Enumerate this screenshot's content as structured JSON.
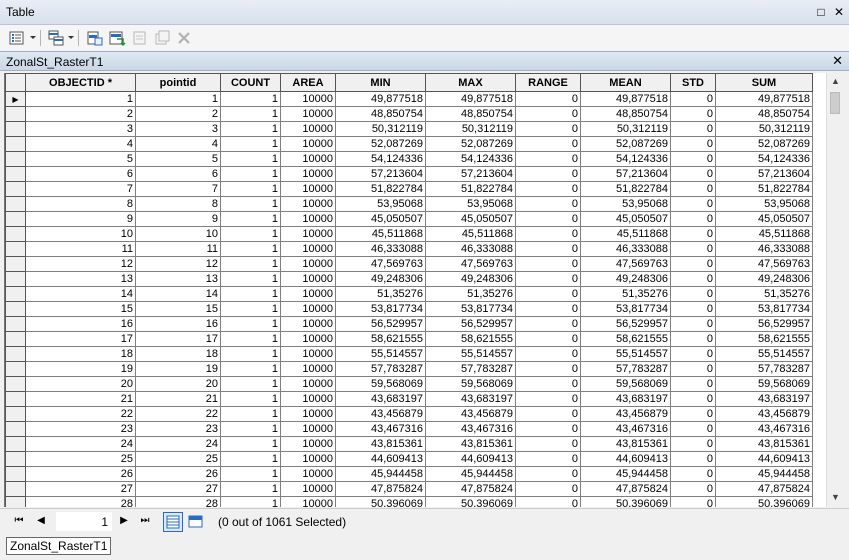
{
  "window": {
    "title": "Table",
    "restore_symbol": "□",
    "close_symbol": "✕"
  },
  "toolbar": {
    "icons": [
      "table-options-icon",
      "related-tables-icon",
      "select-by-attributes-icon",
      "switch-selection-icon",
      "clear-selection-icon",
      "delete-selected-icon",
      "delete-icon"
    ]
  },
  "table_tab": {
    "title": "ZonalSt_RasterT1",
    "close_symbol": "✕"
  },
  "grid": {
    "columns": [
      "OBJECTID *",
      "pointid",
      "COUNT",
      "AREA",
      "MIN",
      "MAX",
      "RANGE",
      "MEAN",
      "STD",
      "SUM"
    ],
    "rows": [
      [
        "1",
        "1",
        "1",
        "10000",
        "49,877518",
        "49,877518",
        "0",
        "49,877518",
        "0",
        "49,877518"
      ],
      [
        "2",
        "2",
        "1",
        "10000",
        "48,850754",
        "48,850754",
        "0",
        "48,850754",
        "0",
        "48,850754"
      ],
      [
        "3",
        "3",
        "1",
        "10000",
        "50,312119",
        "50,312119",
        "0",
        "50,312119",
        "0",
        "50,312119"
      ],
      [
        "4",
        "4",
        "1",
        "10000",
        "52,087269",
        "52,087269",
        "0",
        "52,087269",
        "0",
        "52,087269"
      ],
      [
        "5",
        "5",
        "1",
        "10000",
        "54,124336",
        "54,124336",
        "0",
        "54,124336",
        "0",
        "54,124336"
      ],
      [
        "6",
        "6",
        "1",
        "10000",
        "57,213604",
        "57,213604",
        "0",
        "57,213604",
        "0",
        "57,213604"
      ],
      [
        "7",
        "7",
        "1",
        "10000",
        "51,822784",
        "51,822784",
        "0",
        "51,822784",
        "0",
        "51,822784"
      ],
      [
        "8",
        "8",
        "1",
        "10000",
        "53,95068",
        "53,95068",
        "0",
        "53,95068",
        "0",
        "53,95068"
      ],
      [
        "9",
        "9",
        "1",
        "10000",
        "45,050507",
        "45,050507",
        "0",
        "45,050507",
        "0",
        "45,050507"
      ],
      [
        "10",
        "10",
        "1",
        "10000",
        "45,511868",
        "45,511868",
        "0",
        "45,511868",
        "0",
        "45,511868"
      ],
      [
        "11",
        "11",
        "1",
        "10000",
        "46,333088",
        "46,333088",
        "0",
        "46,333088",
        "0",
        "46,333088"
      ],
      [
        "12",
        "12",
        "1",
        "10000",
        "47,569763",
        "47,569763",
        "0",
        "47,569763",
        "0",
        "47,569763"
      ],
      [
        "13",
        "13",
        "1",
        "10000",
        "49,248306",
        "49,248306",
        "0",
        "49,248306",
        "0",
        "49,248306"
      ],
      [
        "14",
        "14",
        "1",
        "10000",
        "51,35276",
        "51,35276",
        "0",
        "51,35276",
        "0",
        "51,35276"
      ],
      [
        "15",
        "15",
        "1",
        "10000",
        "53,817734",
        "53,817734",
        "0",
        "53,817734",
        "0",
        "53,817734"
      ],
      [
        "16",
        "16",
        "1",
        "10000",
        "56,529957",
        "56,529957",
        "0",
        "56,529957",
        "0",
        "56,529957"
      ],
      [
        "17",
        "17",
        "1",
        "10000",
        "58,621555",
        "58,621555",
        "0",
        "58,621555",
        "0",
        "58,621555"
      ],
      [
        "18",
        "18",
        "1",
        "10000",
        "55,514557",
        "55,514557",
        "0",
        "55,514557",
        "0",
        "55,514557"
      ],
      [
        "19",
        "19",
        "1",
        "10000",
        "57,783287",
        "57,783287",
        "0",
        "57,783287",
        "0",
        "57,783287"
      ],
      [
        "20",
        "20",
        "1",
        "10000",
        "59,568069",
        "59,568069",
        "0",
        "59,568069",
        "0",
        "59,568069"
      ],
      [
        "21",
        "21",
        "1",
        "10000",
        "43,683197",
        "43,683197",
        "0",
        "43,683197",
        "0",
        "43,683197"
      ],
      [
        "22",
        "22",
        "1",
        "10000",
        "43,456879",
        "43,456879",
        "0",
        "43,456879",
        "0",
        "43,456879"
      ],
      [
        "23",
        "23",
        "1",
        "10000",
        "43,467316",
        "43,467316",
        "0",
        "43,467316",
        "0",
        "43,467316"
      ],
      [
        "24",
        "24",
        "1",
        "10000",
        "43,815361",
        "43,815361",
        "0",
        "43,815361",
        "0",
        "43,815361"
      ],
      [
        "25",
        "25",
        "1",
        "10000",
        "44,609413",
        "44,609413",
        "0",
        "44,609413",
        "0",
        "44,609413"
      ],
      [
        "26",
        "26",
        "1",
        "10000",
        "45,944458",
        "45,944458",
        "0",
        "45,944458",
        "0",
        "45,944458"
      ],
      [
        "27",
        "27",
        "1",
        "10000",
        "47,875824",
        "47,875824",
        "0",
        "47,875824",
        "0",
        "47,875824"
      ],
      [
        "28",
        "28",
        "1",
        "10000",
        "50,396069",
        "50,396069",
        "0",
        "50,396069",
        "0",
        "50,396069"
      ]
    ],
    "current_row_marker": "▶"
  },
  "navigation": {
    "first_symbol": "⏮",
    "prev_symbol": "◀",
    "next_symbol": "▶",
    "last_symbol": "⏭",
    "current_record": "1",
    "selection_status": "(0 out of 1061 Selected)"
  },
  "bottom_tab": {
    "label": "ZonalSt_RasterT1"
  },
  "colors": {
    "accent": "#2a6bc2",
    "grid_line": "#7f7f7f"
  }
}
